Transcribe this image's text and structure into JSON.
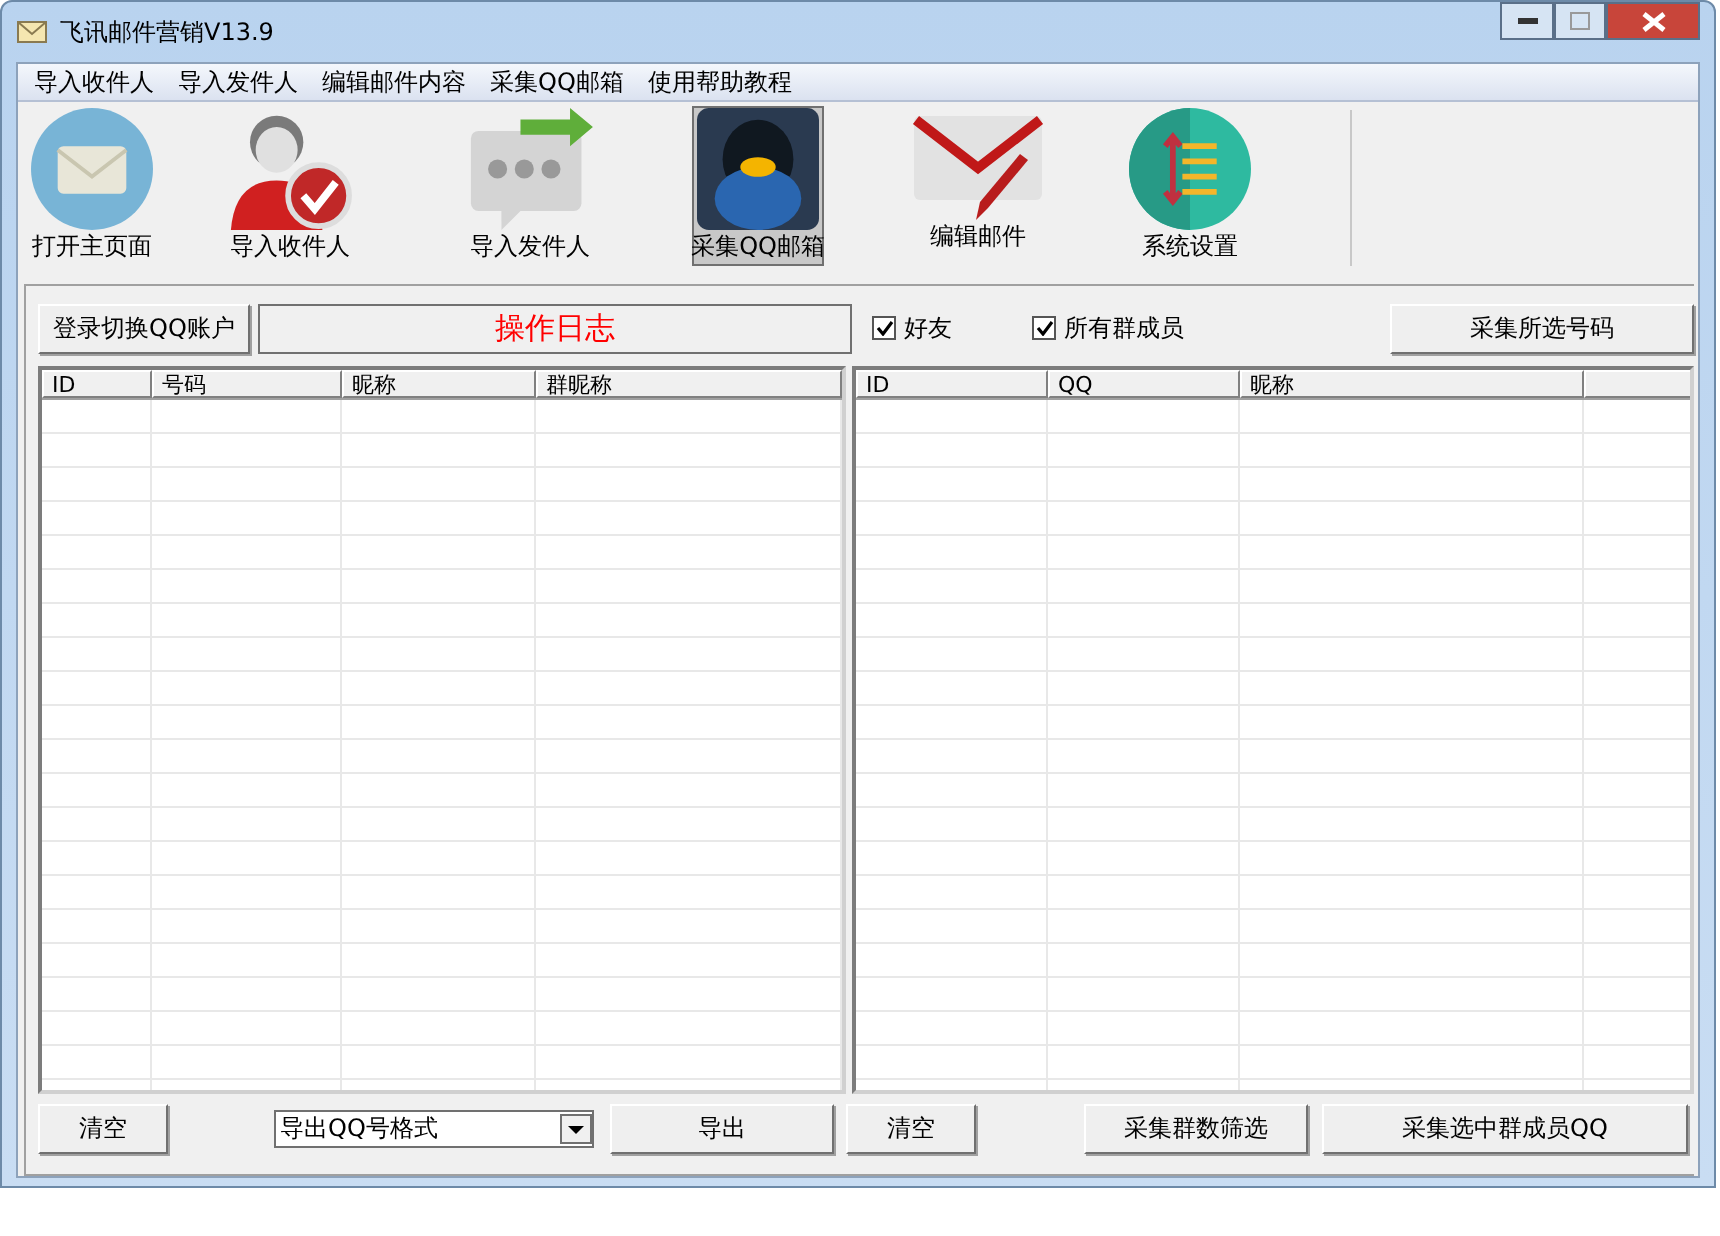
{
  "window": {
    "title": "飞讯邮件营销V13.9"
  },
  "menu": [
    "导入收件人",
    "导入发件人",
    "编辑邮件内容",
    "采集QQ邮箱",
    "使用帮助教程"
  ],
  "toolbar": [
    {
      "kind": "home",
      "label": "打开主页面",
      "selected": false
    },
    {
      "kind": "recipients",
      "label": "导入收件人",
      "selected": false
    },
    {
      "kind": "senders",
      "label": "导入发件人",
      "selected": false
    },
    {
      "kind": "collect",
      "label": "采集QQ邮箱",
      "selected": true
    },
    {
      "kind": "edit",
      "label": "编辑邮件",
      "selected": false
    },
    {
      "kind": "settings",
      "label": "系统设置",
      "selected": false
    }
  ],
  "login_button": "登录切换QQ账户",
  "log_title": "操作日志",
  "checkboxes": [
    {
      "label": "好友",
      "checked": true
    },
    {
      "label": "所有群成员",
      "checked": true
    }
  ],
  "collect_selected_button": "采集所选号码",
  "left_table": {
    "columns": [
      "ID",
      "号码",
      "昵称",
      "群昵称"
    ]
  },
  "right_table": {
    "columns": [
      "ID",
      "QQ",
      "昵称"
    ]
  },
  "left_footer": {
    "clear": "清空",
    "export_format": "导出QQ号格式",
    "export": "导出"
  },
  "right_footer": {
    "clear": "清空",
    "filter": "采集群数筛选",
    "collect_members": "采集选中群成员QQ"
  }
}
